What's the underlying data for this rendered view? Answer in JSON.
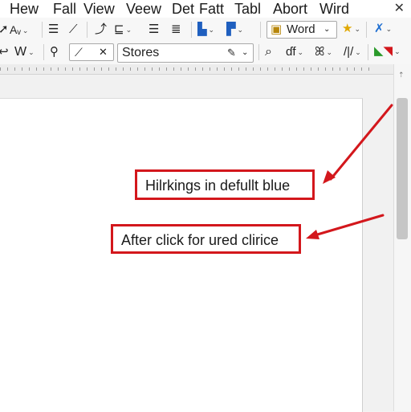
{
  "menu": {
    "items": [
      "Hew",
      "Fall",
      "View",
      "Veew",
      "Det",
      "Fatt",
      "Tabl",
      "Abort",
      "Wird"
    ],
    "close_glyph": "✕"
  },
  "ribbon": {
    "row1": {
      "font_size_label": "Aᵥ",
      "style_box_label": "Word",
      "icons": [
        "arrow-icon",
        "font-size-icon",
        "align-icon",
        "brush-icon",
        "pen-icon",
        "format-icon",
        "lines-icon",
        "paragraph-icon",
        "bookmark-icon",
        "cursor-icon",
        "star-icon",
        "tools-icon"
      ]
    },
    "row2": {
      "font_label": "W",
      "style_dropdown_value": "Stores",
      "search_glyph": "⌕",
      "format_label": "ɗf",
      "slash_label": "/|/"
    }
  },
  "annotations": [
    {
      "text": "Hilrkings in defullt blue"
    },
    {
      "text": "After click for ured clirice"
    }
  ],
  "colors": {
    "annotation_red": "#d3171c",
    "page_bg": "#ffffff",
    "chrome_bg": "#f7f7f7"
  }
}
